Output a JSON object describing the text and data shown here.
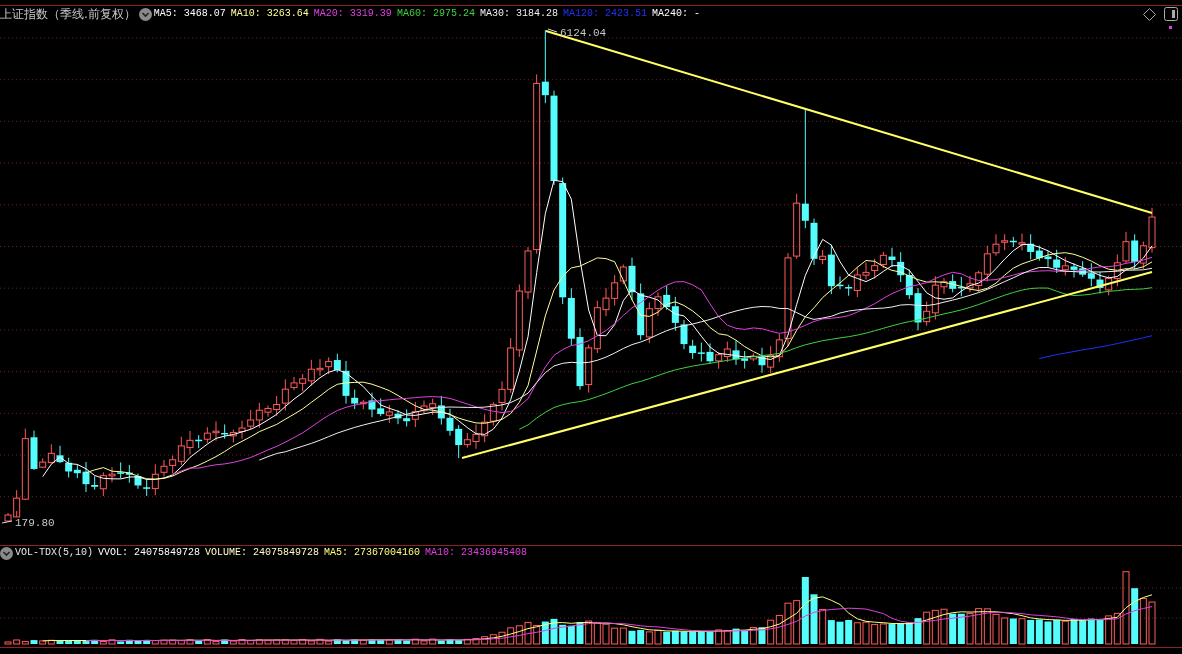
{
  "chart_header": {
    "title": "上证指数（季线.前复权）",
    "indicators": [
      {
        "label": "MA5:",
        "value": "3468.07",
        "color": "#ffffff"
      },
      {
        "label": "MA10:",
        "value": "3263.64",
        "color": "#ffff99"
      },
      {
        "label": "MA20:",
        "value": "3319.39",
        "color": "#e040e0"
      },
      {
        "label": "MA60:",
        "value": "2975.24",
        "color": "#40d040"
      },
      {
        "label": "MA30:",
        "value": "3184.28",
        "color": "#f0f0f0"
      },
      {
        "label": "MA120:",
        "value": "2423.51",
        "color": "#2030ff"
      },
      {
        "label": "MA240:",
        "value": "-",
        "color": "#ffffff"
      }
    ]
  },
  "main_chart": {
    "high_label": "6124.04",
    "low_label": "179.80"
  },
  "volume_header": {
    "name": "VOL-TDX(5,10)",
    "indicators": [
      {
        "label": "VVOL:",
        "value": "24075849728",
        "color": "#ffffff"
      },
      {
        "label": "VOLUME:",
        "value": "24075849728",
        "color": "#ffffc8"
      },
      {
        "label": "MA5:",
        "value": "27367004160",
        "color": "#ffff80"
      },
      {
        "label": "MA10:",
        "value": "23436945408",
        "color": "#e040e0"
      }
    ]
  }
}
